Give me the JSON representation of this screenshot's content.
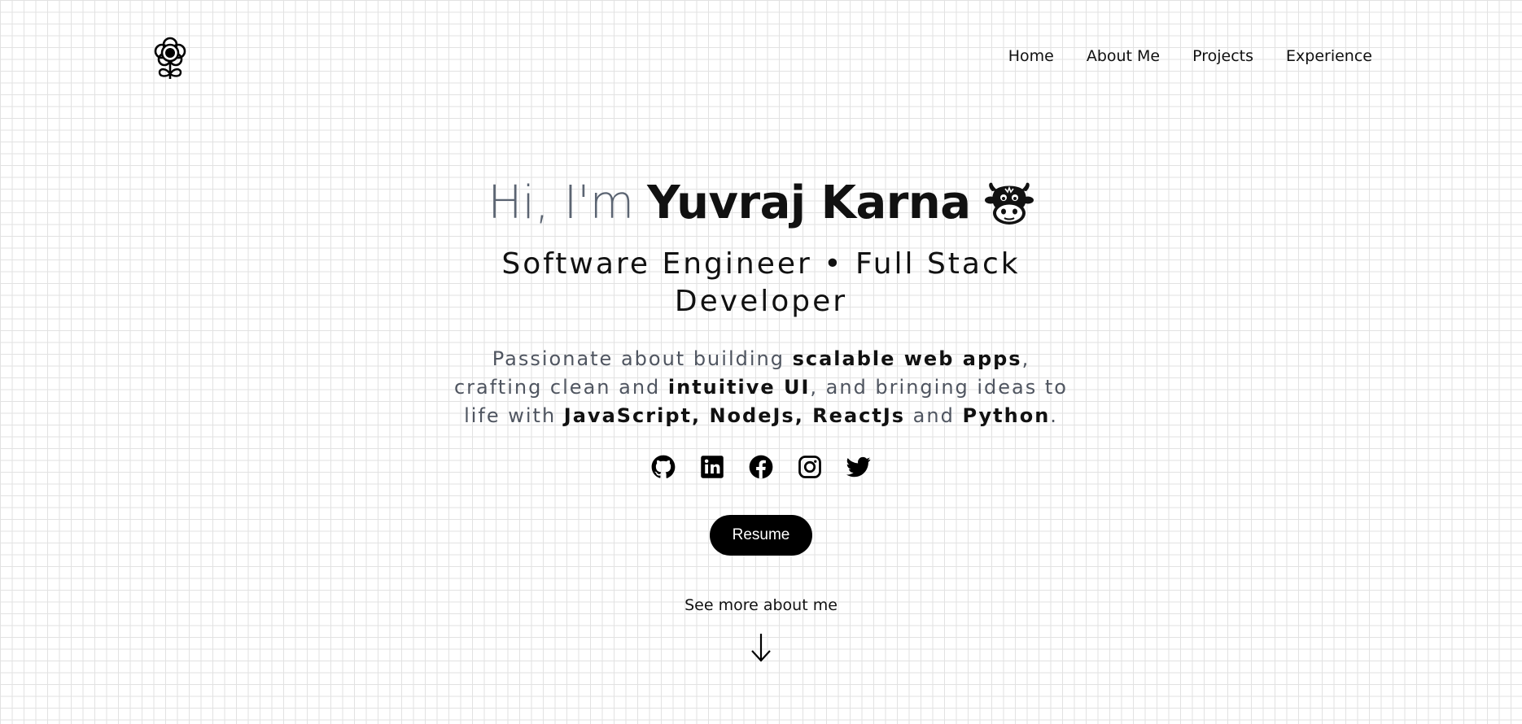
{
  "nav": {
    "items": [
      "Home",
      "About Me",
      "Projects",
      "Experience"
    ]
  },
  "hero": {
    "greeting_prefix": "Hi, I'm",
    "name": "Yuvraj Karna",
    "subtitle": "Software Engineer • Full Stack Developer",
    "desc": {
      "t1": "Passionate about building ",
      "b1": "scalable web apps",
      "t2": ", crafting clean and ",
      "b2": "intuitive UI",
      "t3": ", and bringing ideas to life with ",
      "b3": "JavaScript, NodeJs, ReactJs",
      "t4": " and ",
      "b4": "Python",
      "t5": "."
    },
    "resume_label": "Resume",
    "more_label": "See more about me"
  },
  "icons": {
    "logo": "flower-icon",
    "bull": "cow-emoji-icon",
    "socials": [
      "github-icon",
      "linkedin-icon",
      "facebook-icon",
      "instagram-icon",
      "twitter-icon"
    ],
    "scroll": "arrow-down-icon"
  },
  "colors": {
    "text": "#111111",
    "muted": "#5b6472",
    "button": "#000000"
  }
}
